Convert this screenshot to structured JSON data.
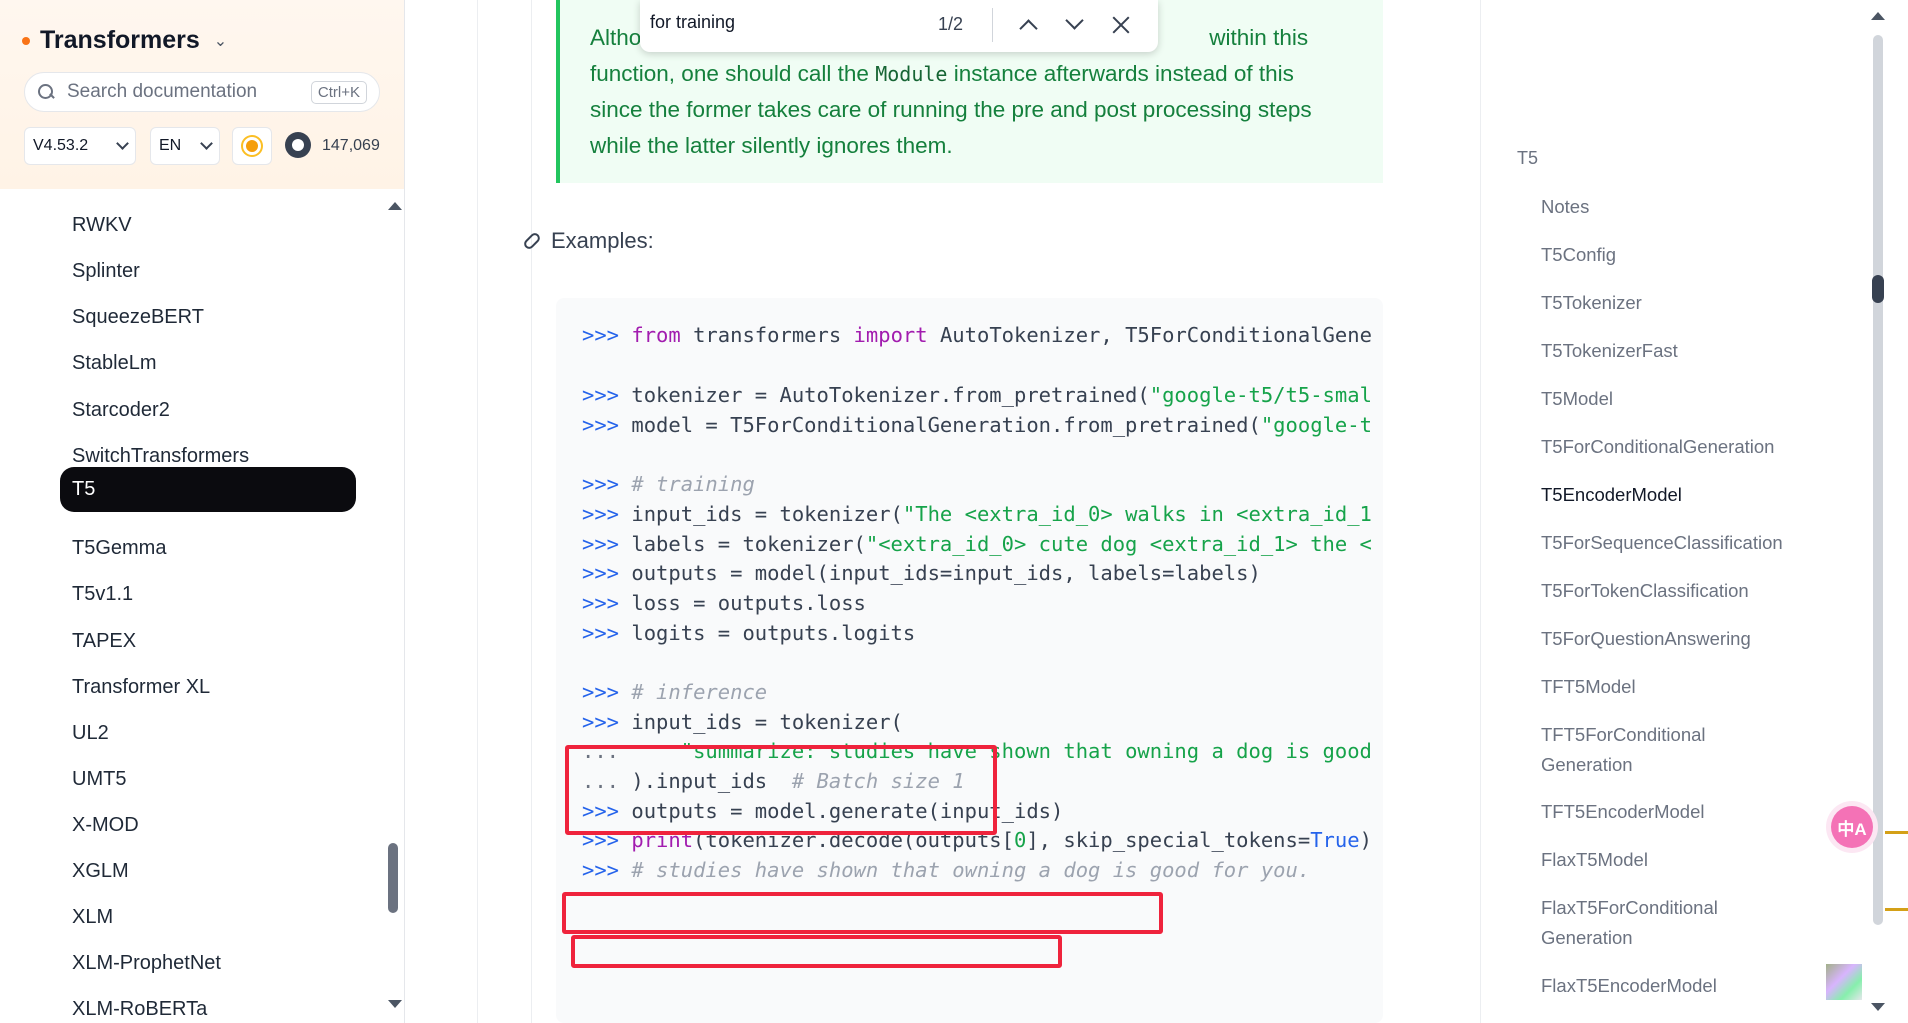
{
  "sidebar": {
    "brand": "Transformers",
    "search_placeholder": "Search documentation",
    "search_shortcut": "Ctrl+K",
    "version": "V4.53.2",
    "language": "EN",
    "github_stars": "147,069",
    "items": [
      "RWKV",
      "Splinter",
      "SqueezeBERT",
      "StableLm",
      "Starcoder2",
      "SwitchTransformers",
      "T5",
      "T5Gemma",
      "T5v1.1",
      "TAPEX",
      "Transformer XL",
      "UL2",
      "UMT5",
      "X-MOD",
      "XGLM",
      "XLM",
      "XLM-ProphetNet",
      "XLM-RoBERTa"
    ],
    "active_item": "T5"
  },
  "find_bar": {
    "query": "for training",
    "count": "1/2"
  },
  "tip": {
    "part1": "Altho",
    "part2": "within this",
    "line2a": "function, one should call the ",
    "code": "Module",
    "line2b": " instance afterwards instead of this",
    "line3": "since the former takes care of running the pre and post processing steps",
    "line4": "while the latter silently ignores them."
  },
  "examples_title": "Examples:",
  "code": {
    "prompt": ">>>",
    "cont": "...",
    "l1_kw1": "from",
    "l1_a": " transformers ",
    "l1_kw2": "import",
    "l1_b": " AutoTokenizer, T5ForConditionalGene",
    "l2_a": " tokenizer = AutoTokenizer.from_pretrained(",
    "l2_s": "\"google-t5/t5-smal",
    "l3_a": " model = T5ForConditionalGeneration.from_pretrained(",
    "l3_s": "\"google-t",
    "l4_c": "# training",
    "l5_a": " input_ids = tokenizer(",
    "l5_s": "\"The <extra_id_0> walks in <extra_id_1",
    "l6_a": " labels = tokenizer(",
    "l6_s": "\"<extra_id_0> cute dog <extra_id_1> the <",
    "l7": " outputs = model(input_ids=input_ids, labels=labels)",
    "l8": " loss = outputs.loss",
    "l9": " logits = outputs.logits",
    "l10_c": "# inference",
    "l11": " input_ids = tokenizer(",
    "l12_s": "\"summarize: studies have shown that owning a dog is good",
    "l13_a": " ).input_ids  ",
    "l13_c": "# Batch size 1",
    "l14": " outputs = model.generate(input_ids)",
    "l15_kw": "print",
    "l15_a": "(tokenizer.decode(outputs[",
    "l15_n": "0",
    "l15_b": "], skip_special_tokens=",
    "l15_t": "True",
    "l15_c": ")",
    "l16_c": "# studies have shown that owning a dog is good for you."
  },
  "toc": {
    "top": "T5",
    "items": [
      "Notes",
      "T5Config",
      "T5Tokenizer",
      "T5TokenizerFast",
      "T5Model",
      "T5ForConditionalGeneration",
      "T5EncoderModel",
      "T5ForSequenceClassification",
      "T5ForTokenClassification",
      "T5ForQuestionAnswering",
      "TFT5Model",
      "TFT5ForConditional",
      "Generation",
      "TFT5EncoderModel",
      "FlaxT5Model",
      "FlaxT5ForConditional",
      "Generation",
      "FlaxT5EncoderModel"
    ],
    "current": "T5EncoderModel"
  },
  "translate_label": "中A"
}
